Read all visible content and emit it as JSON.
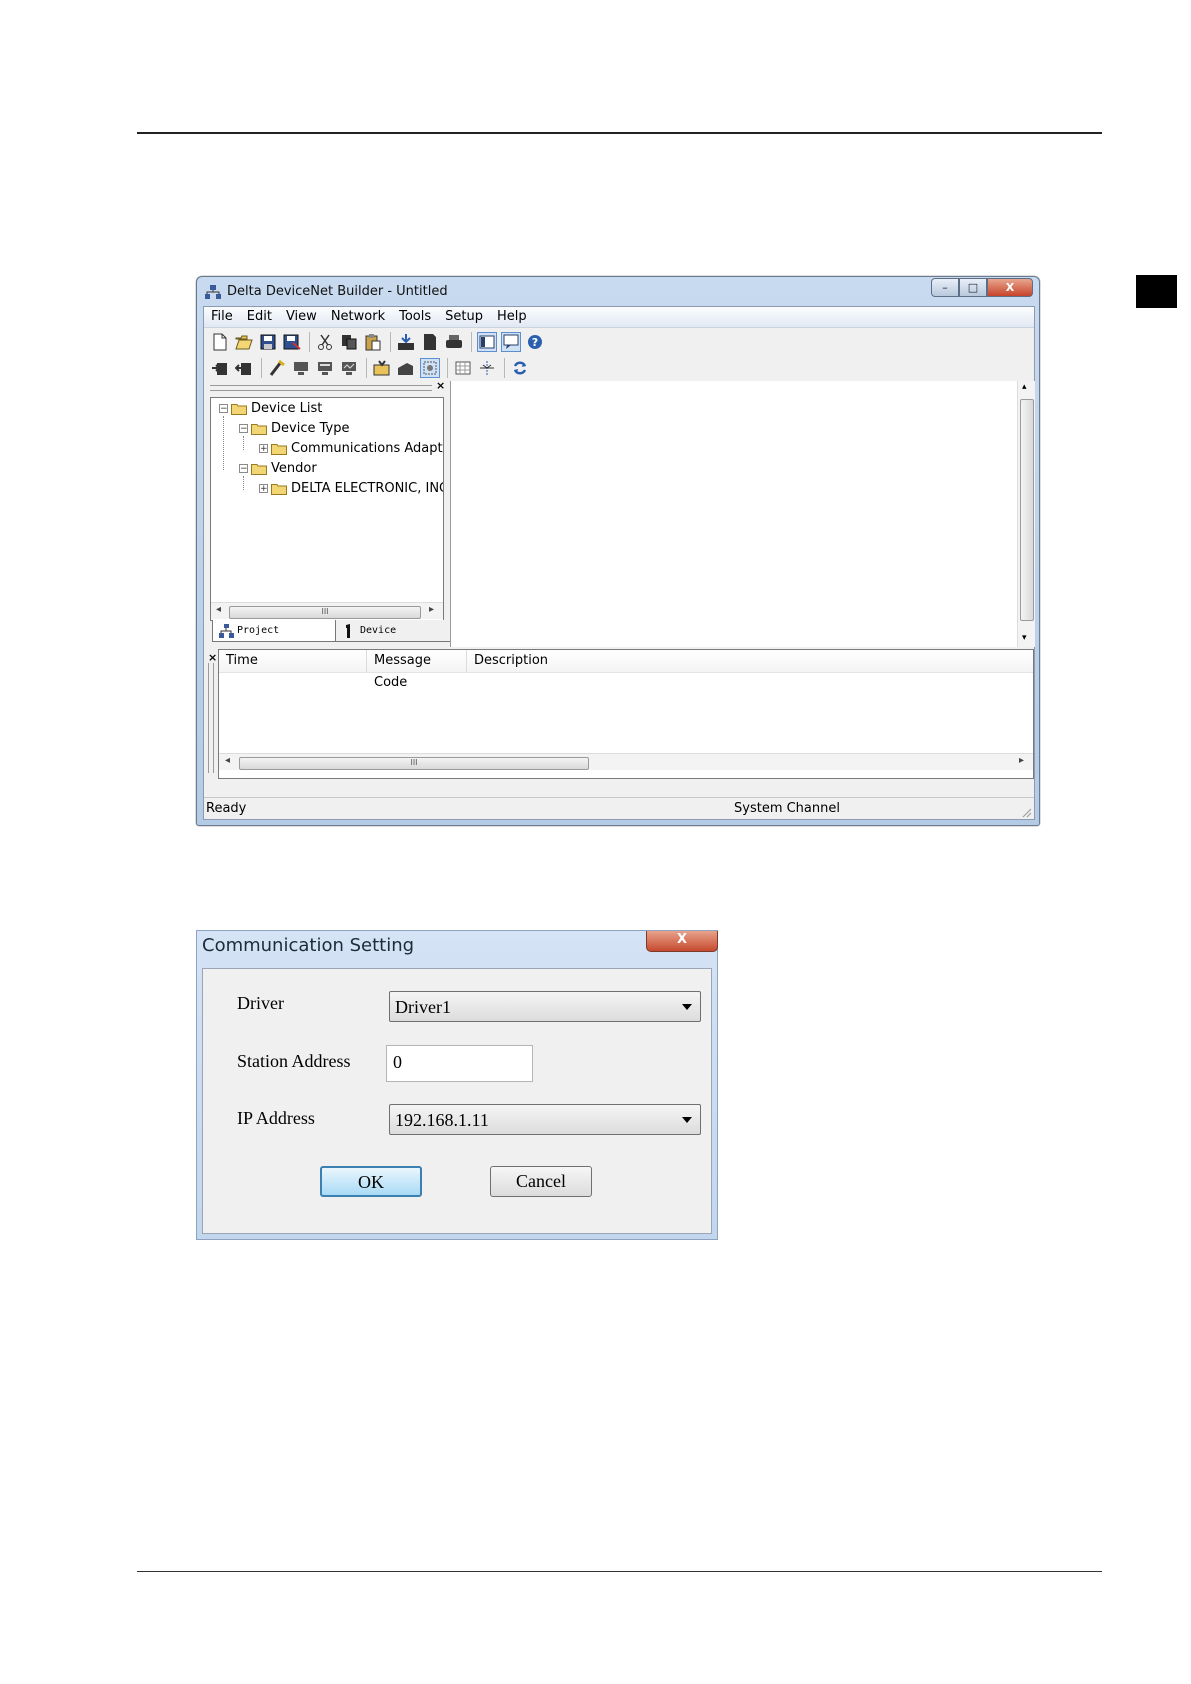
{
  "main_window": {
    "title": "Delta DeviceNet Builder - Untitled",
    "controls": {
      "minimize": "–",
      "maximize": "□",
      "close": "X"
    },
    "menu": [
      "File",
      "Edit",
      "View",
      "Network",
      "Tools",
      "Setup",
      "Help"
    ],
    "toolbar_row1": [
      "new-file-icon",
      "open-folder-icon",
      "save-icon",
      "save-as-icon",
      "cut-icon",
      "copy-icon",
      "paste-icon",
      "download-icon",
      "upload-icon",
      "print-icon",
      "project-view-icon",
      "message-view-icon",
      "help-icon"
    ],
    "toolbar_row2": [
      "online-icon",
      "offline-icon",
      "scan-icon",
      "monitor-icon",
      "config-icon",
      "diagnose-icon",
      "load-icon",
      "eds-icon",
      "property-icon",
      "grid-icon",
      "align-icon",
      "refresh-icon"
    ],
    "left_pane": {
      "close": "×",
      "tree": [
        {
          "label": "Device List",
          "level": 0,
          "toggle": "−"
        },
        {
          "label": "Device Type",
          "level": 1,
          "toggle": "−"
        },
        {
          "label": "Communications Adapter",
          "level": 2,
          "toggle": "+"
        },
        {
          "label": "Vendor",
          "level": 1,
          "toggle": "−"
        },
        {
          "label": "DELTA ELECTRONIC, INC.",
          "level": 2,
          "toggle": "+"
        }
      ],
      "tabs": {
        "project": "Project",
        "device": "Device"
      },
      "scroll_thumb": "III"
    },
    "message_pane": {
      "close": "×",
      "columns": [
        "Time",
        "Message Code",
        "Description"
      ],
      "scroll_thumb": "III"
    },
    "status": {
      "left": "Ready",
      "right": "System Channel"
    }
  },
  "dialog": {
    "title": "Communication Setting",
    "close": "X",
    "driver": {
      "label": "Driver",
      "value": "Driver1"
    },
    "station": {
      "label": "Station Address",
      "value": "0"
    },
    "ip": {
      "label": "IP Address",
      "value": "192.168.1.11"
    },
    "ok": "OK",
    "cancel": "Cancel"
  },
  "colors": {
    "title_blue": "#c8daef",
    "close_red": "#c7432a",
    "ok_border": "#3c7fb1"
  }
}
